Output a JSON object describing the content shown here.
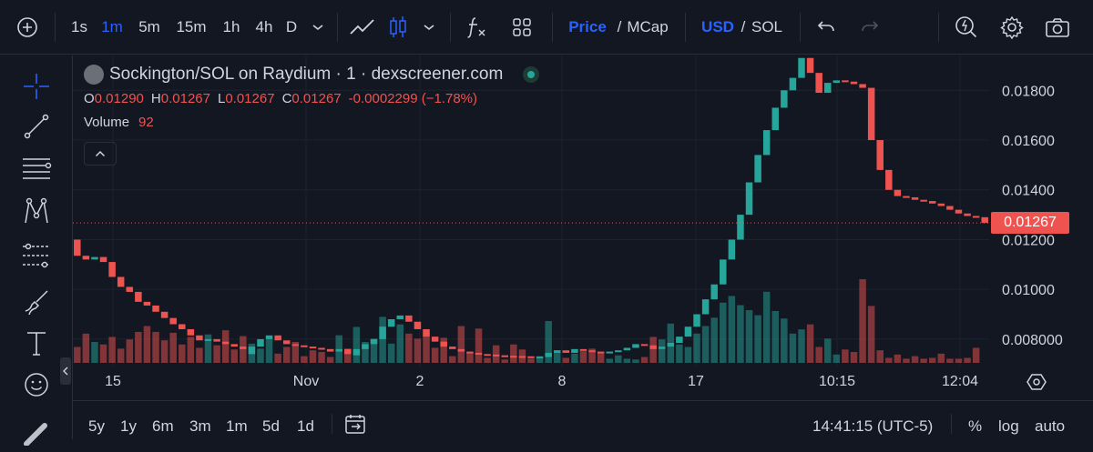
{
  "toolbar": {
    "intervals": [
      "1s",
      "1m",
      "5m",
      "15m",
      "1h",
      "4h",
      "D"
    ],
    "active_interval": "1m",
    "price_label": "Price",
    "slash1": "/",
    "mcap_label": "MCap",
    "usd_label": "USD",
    "slash2": "/",
    "sol_label": "SOL"
  },
  "legend": {
    "title": "Sockington/SOL on Raydium · 1 · dexscreener.com",
    "ohlc": [
      {
        "k": "O",
        "v": "0.01290"
      },
      {
        "k": "H",
        "v": "0.01267"
      },
      {
        "k": "L",
        "v": "0.01267"
      },
      {
        "k": "C",
        "v": "0.01267"
      }
    ],
    "change": "-0.0002299 (−1.78%)",
    "volume_label": "Volume",
    "volume_value": "92"
  },
  "price_axis": {
    "labels": [
      "0.01800",
      "0.01600",
      "0.01400",
      "0.01200",
      "0.01000",
      "0.008000"
    ],
    "current_price": "0.01267"
  },
  "time_axis": {
    "labels": [
      "15",
      "Nov",
      "2",
      "8",
      "17",
      "10:15",
      "12:04"
    ]
  },
  "bottom_bar": {
    "ranges": [
      "5y",
      "1y",
      "6m",
      "3m",
      "1m",
      "5d",
      "1d"
    ],
    "time": "14:41:15 (UTC-5)",
    "pct": "%",
    "log": "log",
    "auto": "auto"
  },
  "colors": {
    "up": "#26a69a",
    "down": "#ef5350",
    "background": "#131722",
    "grid": "#1e222d",
    "accent": "#2962ff"
  },
  "chart_data": {
    "type": "candlestick",
    "y_range": [
      0.0069,
      0.0194
    ],
    "price_ticks": [
      0.018,
      0.016,
      0.014,
      0.012,
      0.01,
      0.008
    ],
    "current_price": 0.01267,
    "candles": [
      [
        0.012,
        0.01135
      ],
      [
        0.01135,
        0.0112
      ],
      [
        0.0112,
        0.0113
      ],
      [
        0.0113,
        0.0111
      ],
      [
        0.0111,
        0.0105
      ],
      [
        0.0105,
        0.0101
      ],
      [
        0.0101,
        0.0099
      ],
      [
        0.0099,
        0.0095
      ],
      [
        0.0095,
        0.00935
      ],
      [
        0.00935,
        0.0091
      ],
      [
        0.0091,
        0.00885
      ],
      [
        0.00885,
        0.0086
      ],
      [
        0.0086,
        0.0084
      ],
      [
        0.0084,
        0.00815
      ],
      [
        0.00815,
        0.00795
      ],
      [
        0.00795,
        0.008
      ],
      [
        0.008,
        0.0079
      ],
      [
        0.0079,
        0.0078
      ],
      [
        0.0078,
        0.0077
      ],
      [
        0.0077,
        0.0076
      ],
      [
        0.0074,
        0.0077
      ],
      [
        0.0077,
        0.008
      ],
      [
        0.008,
        0.00815
      ],
      [
        0.00815,
        0.00795
      ],
      [
        0.00795,
        0.0078
      ],
      [
        0.0078,
        0.00775
      ],
      [
        0.00775,
        0.0077
      ],
      [
        0.0077,
        0.00765
      ],
      [
        0.00765,
        0.0076
      ],
      [
        0.0076,
        0.0075
      ],
      [
        0.0075,
        0.0076
      ],
      [
        0.0076,
        0.0074
      ],
      [
        0.00735,
        0.0076
      ],
      [
        0.0076,
        0.0078
      ],
      [
        0.0078,
        0.008
      ],
      [
        0.008,
        0.0085
      ],
      [
        0.0085,
        0.0088
      ],
      [
        0.0088,
        0.00895
      ],
      [
        0.00895,
        0.0087
      ],
      [
        0.0087,
        0.0084
      ],
      [
        0.0084,
        0.0081
      ],
      [
        0.0081,
        0.0079
      ],
      [
        0.0079,
        0.0077
      ],
      [
        0.0077,
        0.0076
      ],
      [
        0.0076,
        0.0075
      ],
      [
        0.0075,
        0.00745
      ],
      [
        0.00745,
        0.0074
      ],
      [
        0.0074,
        0.00738
      ],
      [
        0.00738,
        0.00735
      ],
      [
        0.00735,
        0.00733
      ],
      [
        0.00733,
        0.00732
      ],
      [
        0.00732,
        0.00731
      ],
      [
        0.00731,
        0.0073
      ],
      [
        0.0073,
        0.0073
      ],
      [
        0.00728,
        0.00745
      ],
      [
        0.00745,
        0.00755
      ],
      [
        0.00755,
        0.00745
      ],
      [
        0.00745,
        0.0076
      ],
      [
        0.0076,
        0.00755
      ],
      [
        0.00755,
        0.0075
      ],
      [
        0.0075,
        0.00745
      ],
      [
        0.00745,
        0.0075
      ],
      [
        0.0075,
        0.00755
      ],
      [
        0.00755,
        0.00765
      ],
      [
        0.00765,
        0.0078
      ],
      [
        0.0078,
        0.00775
      ],
      [
        0.00775,
        0.0076
      ],
      [
        0.0076,
        0.0077
      ],
      [
        0.0077,
        0.00785
      ],
      [
        0.00785,
        0.0081
      ],
      [
        0.0081,
        0.0085
      ],
      [
        0.0085,
        0.009
      ],
      [
        0.009,
        0.0096
      ],
      [
        0.0096,
        0.0102
      ],
      [
        0.0102,
        0.0112
      ],
      [
        0.0112,
        0.012
      ],
      [
        0.012,
        0.013
      ],
      [
        0.013,
        0.0143
      ],
      [
        0.0143,
        0.0154
      ],
      [
        0.0154,
        0.0164
      ],
      [
        0.0164,
        0.0173
      ],
      [
        0.0173,
        0.018
      ],
      [
        0.018,
        0.0185
      ],
      [
        0.0185,
        0.0193
      ],
      [
        0.0193,
        0.0187
      ],
      [
        0.0187,
        0.0179
      ],
      [
        0.0179,
        0.0183
      ],
      [
        0.0183,
        0.0184
      ],
      [
        0.0184,
        0.01835
      ],
      [
        0.01835,
        0.01825
      ],
      [
        0.01825,
        0.0181
      ],
      [
        0.0181,
        0.016
      ],
      [
        0.016,
        0.0148
      ],
      [
        0.0148,
        0.014
      ],
      [
        0.014,
        0.01375
      ],
      [
        0.01375,
        0.0137
      ],
      [
        0.0137,
        0.0136
      ],
      [
        0.0136,
        0.01355
      ],
      [
        0.01355,
        0.01345
      ],
      [
        0.01345,
        0.01335
      ],
      [
        0.01335,
        0.0132
      ],
      [
        0.0132,
        0.01305
      ],
      [
        0.01305,
        0.01295
      ],
      [
        0.01295,
        0.0129
      ],
      [
        0.0129,
        0.01267
      ]
    ],
    "volumes": [
      0.19,
      0.35,
      0.25,
      0.22,
      0.31,
      0.17,
      0.28,
      0.37,
      0.44,
      0.37,
      0.27,
      0.36,
      0.22,
      0.31,
      0.18,
      0.34,
      0.21,
      0.39,
      0.16,
      0.32,
      0.23,
      0.17,
      0.29,
      0.11,
      0.19,
      0.25,
      0.08,
      0.15,
      0.13,
      0.07,
      0.33,
      0.17,
      0.43,
      0.25,
      0.29,
      0.55,
      0.23,
      0.46,
      0.35,
      0.29,
      0.36,
      0.18,
      0.3,
      0.08,
      0.44,
      0.12,
      0.41,
      0.06,
      0.21,
      0.04,
      0.22,
      0.16,
      0.05,
      0.08,
      0.5,
      0.15,
      0.06,
      0.11,
      0.14,
      0.17,
      0.13,
      0.05,
      0.09,
      0.05,
      0.04,
      0.07,
      0.31,
      0.28,
      0.47,
      0.22,
      0.19,
      0.35,
      0.44,
      0.54,
      0.72,
      0.8,
      0.69,
      0.63,
      0.57,
      0.85,
      0.62,
      0.53,
      0.35,
      0.4,
      0.46,
      0.19,
      0.29,
      0.1,
      0.16,
      0.13,
      1.0,
      0.68,
      0.15,
      0.06,
      0.1,
      0.05,
      0.08,
      0.05,
      0.06,
      0.11,
      0.05,
      0.05,
      0.06,
      0.18
    ],
    "title": "Sockington/SOL on Raydium · 1 · dexscreener.com",
    "xlabel": "",
    "ylabel": "",
    "grid": true
  }
}
